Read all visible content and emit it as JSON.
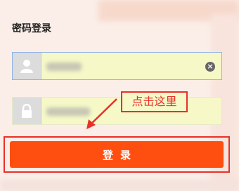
{
  "login": {
    "title": "密码登录",
    "button_label": "登录"
  },
  "username_field": {
    "icon": "user-icon",
    "clear_icon": "clear-icon",
    "clear_glyph": "×"
  },
  "password_field": {
    "icon": "lock-icon"
  },
  "annotation": {
    "text": "点击这里"
  },
  "colors": {
    "primary_button": "#ff4f10",
    "annotation_red": "#e8302a",
    "autofill_bg": "#f6f9c7"
  }
}
